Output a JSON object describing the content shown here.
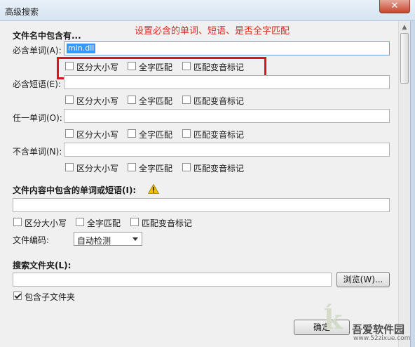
{
  "window": {
    "title": "高级搜索",
    "close_label": "✕"
  },
  "annotation": "设置必含的单词、短语、是否全字匹配",
  "filename_section": {
    "title": "文件名中包含有...",
    "rows": [
      {
        "label": "必含单词(A):",
        "value": "min.dll"
      },
      {
        "label": "必含短语(E):",
        "value": ""
      },
      {
        "label": "任一单词(O):",
        "value": ""
      },
      {
        "label": "不含单词(N):",
        "value": ""
      }
    ],
    "options": {
      "case": "区分大小写",
      "whole": "全字匹配",
      "diacritics": "匹配变音标记"
    }
  },
  "content_section": {
    "title": "文件内容中包含的单词或短语(I):",
    "value": "",
    "options": {
      "case": "区分大小写",
      "whole": "全字匹配",
      "diacritics": "匹配变音标记"
    },
    "encoding_label": "文件编码:",
    "encoding_value": "自动检测"
  },
  "folder_section": {
    "title": "搜索文件夹(L):",
    "value": "",
    "browse_label": "浏览(W)...",
    "subfolders_label": "包含子文件夹",
    "subfolders_checked": true
  },
  "footer": {
    "ok_label": "确定"
  },
  "watermark": {
    "site": "吾爱软件园",
    "url": "www.52zixue.com"
  }
}
